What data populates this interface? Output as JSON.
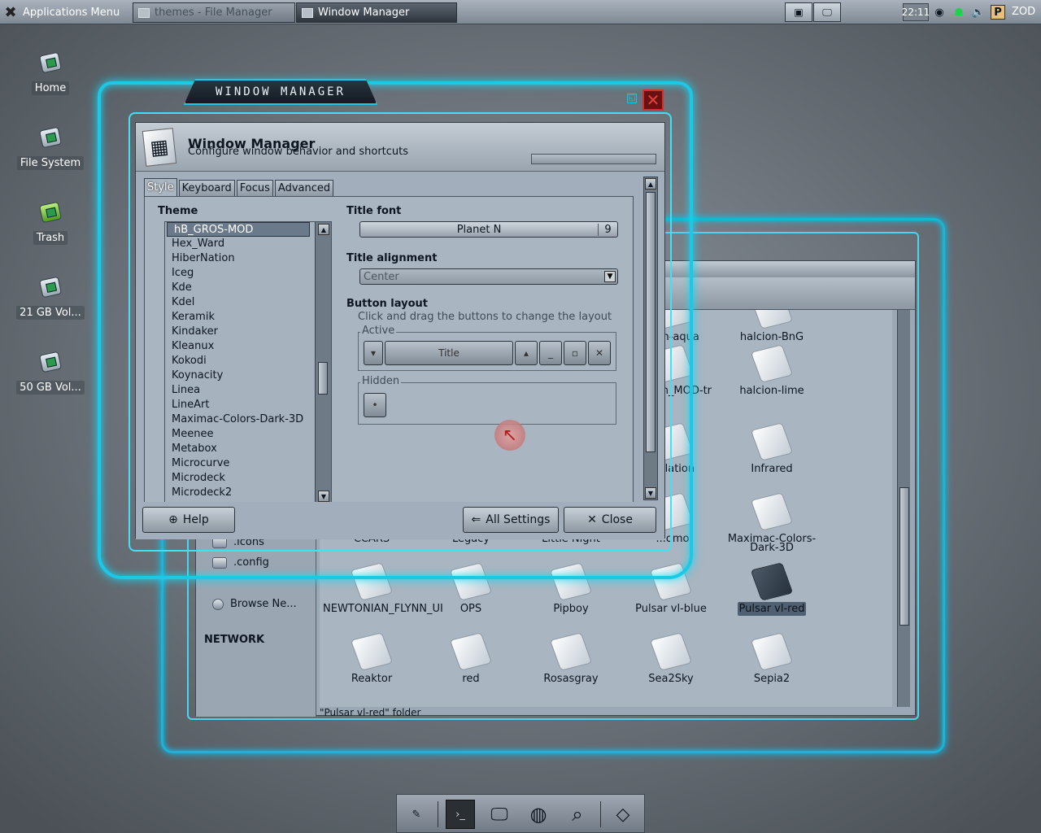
{
  "top_panel": {
    "apps_menu_label": "Applications Menu",
    "tasks": [
      {
        "label": "themes - File Manager"
      },
      {
        "label": "Window Manager"
      }
    ],
    "clock": "22:11",
    "user": "ZOD"
  },
  "desktop_icons": [
    {
      "label": "Home"
    },
    {
      "label": "File System"
    },
    {
      "label": "Trash"
    },
    {
      "label": "21 GB Vol..."
    },
    {
      "label": "50 GB Vol..."
    }
  ],
  "file_manager": {
    "sidebar": {
      "items": [
        ".icons",
        ".config"
      ],
      "network_heading": "NETWORK",
      "network_item": "Browse Ne..."
    },
    "files": [
      {
        "name": "...on-aqua"
      },
      {
        "name": "halcion-BnG"
      },
      {
        "name": "...lcion_MOD-tr"
      },
      {
        "name": "halcion-lime"
      },
      {
        "name": "...rlation"
      },
      {
        "name": "Infrared"
      },
      {
        "name": "CCARS"
      },
      {
        "name": "Legacy"
      },
      {
        "name": "Little Night"
      },
      {
        "name": "...omo"
      },
      {
        "name": "Maximac-Colors-Dark-3D"
      },
      {
        "name": "NEWTONIAN_FLYNN_UI"
      },
      {
        "name": "OPS"
      },
      {
        "name": "Pipboy"
      },
      {
        "name": "Pulsar vl-blue"
      },
      {
        "name": "Pulsar vl-red"
      },
      {
        "name": "Reaktor"
      },
      {
        "name": "red"
      },
      {
        "name": "Rosasgray"
      },
      {
        "name": "Sea2Sky"
      },
      {
        "name": "Sepia2"
      }
    ],
    "status": "\"Pulsar vl-red\" folder"
  },
  "wm": {
    "frame_title": "WINDOW MANAGER",
    "header_title": "Window Manager",
    "header_subtitle": "Configure window behavior and shortcuts",
    "tabs": [
      "Style",
      "Keyboard",
      "Focus",
      "Advanced"
    ],
    "active_tab": "Style",
    "theme_label": "Theme",
    "themes": [
      "hB_GROS-MOD",
      "Hex_Ward",
      "HiberNation",
      "Iceg",
      "Kde",
      "Kdel",
      "Keramik",
      "Kindaker",
      "Kleanux",
      "Kokodi",
      "Koynacity",
      "Linea",
      "LineArt",
      "Maximac-Colors-Dark-3D",
      "Meenee",
      "Metabox",
      "Microcurve",
      "Microdeck",
      "Microdeck2"
    ],
    "selected_theme": "hB_GROS-MOD",
    "title_font_label": "Title font",
    "title_font_name": "Planet N",
    "title_font_size": "9",
    "title_alignment_label": "Title alignment",
    "title_alignment_value": "Center",
    "button_layout_label": "Button layout",
    "button_layout_hint": "Click and drag the buttons to change the layout",
    "active_label": "Active",
    "hidden_label": "Hidden",
    "active_title_button": "Title",
    "help_label": "Help",
    "all_settings_label": "All Settings",
    "close_label": "Close"
  },
  "icons": {
    "apps_menu": "x-logo-icon",
    "dock": [
      "pen-tablet-icon",
      "terminal-icon",
      "monitor-icon",
      "browser-globe-icon",
      "search-magnifier-icon",
      "file-icon"
    ]
  },
  "colors": {
    "frame_cyan": "#1cc8e6",
    "close_red": "#d03030",
    "selection": "#6b7a8a"
  }
}
